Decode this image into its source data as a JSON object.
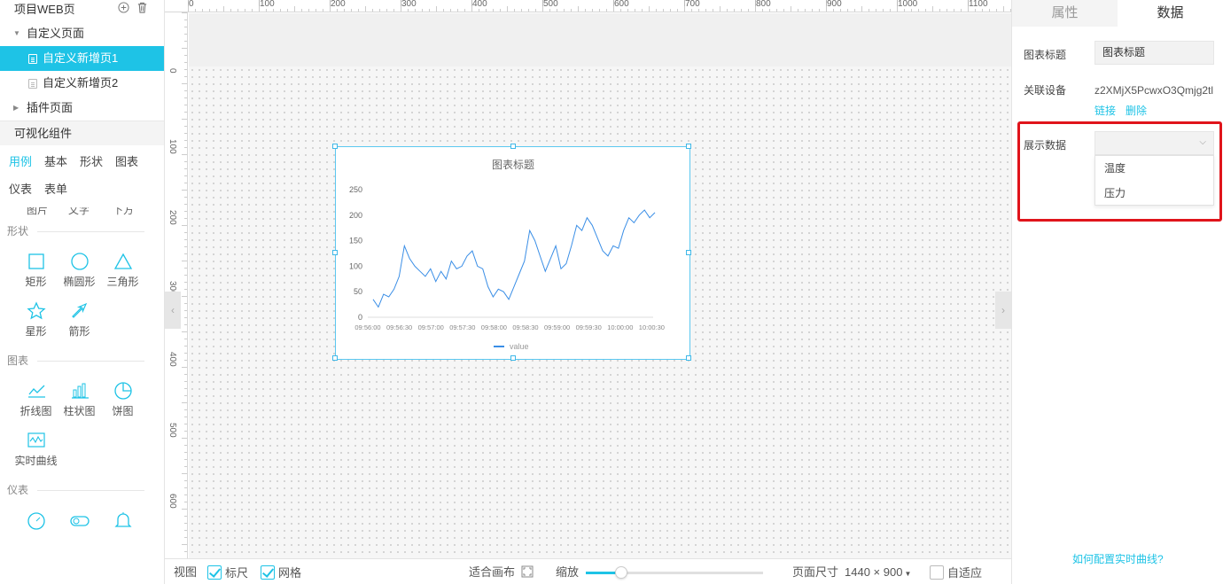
{
  "left_panel": {
    "project_title": "项目WEB页",
    "tree": {
      "custom_group": "自定义页面",
      "pages": [
        "自定义新增页1",
        "自定义新增页2"
      ],
      "plugin_group": "插件页面"
    },
    "components_title": "可视化组件",
    "category_tabs": [
      "用例",
      "基本",
      "形状",
      "图表",
      "仪表",
      "表单"
    ],
    "clipped_labels": [
      "图片",
      "文字",
      "下方"
    ],
    "sections": {
      "shapes": {
        "title": "形状",
        "items": [
          "矩形",
          "椭圆形",
          "三角形",
          "星形",
          "箭形"
        ]
      },
      "charts": {
        "title": "图表",
        "items": [
          "折线图",
          "柱状图",
          "饼图",
          "实时曲线"
        ]
      },
      "gauges": {
        "title": "仪表"
      }
    }
  },
  "rulers": {
    "horizontal": [
      "0",
      "100",
      "200",
      "300",
      "400",
      "500",
      "600",
      "700",
      "800",
      "900",
      "1000",
      "1100"
    ],
    "vertical": [
      "0",
      "100",
      "200",
      "300",
      "400",
      "500",
      "600"
    ]
  },
  "widget": {
    "chart_data": {
      "type": "line",
      "title": "图表标题",
      "x_tick_labels": [
        "09:56:00",
        "09:56:30",
        "09:57:00",
        "09:57:30",
        "09:58:00",
        "09:58:30",
        "09:59:00",
        "09:59:30",
        "10:00:00",
        "10:00:30"
      ],
      "ylim": [
        0,
        250
      ],
      "y_ticks": [
        0,
        50,
        100,
        150,
        200,
        250
      ],
      "legend": "bottom-center",
      "series": [
        {
          "name": "value",
          "color": "#3a8ee6",
          "values": [
            35,
            20,
            45,
            40,
            55,
            80,
            140,
            115,
            100,
            90,
            80,
            95,
            70,
            90,
            75,
            110,
            95,
            100,
            120,
            130,
            100,
            95,
            60,
            40,
            55,
            50,
            35,
            60,
            85,
            110,
            170,
            150,
            120,
            90,
            115,
            140,
            95,
            105,
            140,
            180,
            170,
            195,
            180,
            155,
            130,
            120,
            140,
            135,
            170,
            195,
            185,
            200,
            210,
            195,
            205
          ]
        }
      ]
    }
  },
  "bottom_bar": {
    "view_label": "视图",
    "ruler_label": "标尺",
    "ruler_checked": true,
    "grid_label": "网格",
    "grid_checked": true,
    "fit_canvas_label": "适合画布",
    "zoom_label": "缩放",
    "zoom_fraction": 0.2,
    "page_size_label": "页面尺寸",
    "page_size_value": "1440 × 900",
    "auto_fit_label": "自适应",
    "auto_fit_checked": false
  },
  "right_panel": {
    "tabs": [
      "属性",
      "数据"
    ],
    "active_tab": "数据",
    "chart_title_label": "图表标题",
    "chart_title_value": "图表标题",
    "device_label": "关联设备",
    "device_value": "z2XMjX5PcwxO3Qmjg2tl",
    "link_label": "链接",
    "delete_label": "删除",
    "display_data_label": "展示数据",
    "display_data_value": "",
    "dropdown_options": [
      "温度",
      "压力"
    ],
    "help_link": "如何配置实时曲线?",
    "accent_color": "#1ec3e6",
    "highlight_color": "#e0141b"
  }
}
